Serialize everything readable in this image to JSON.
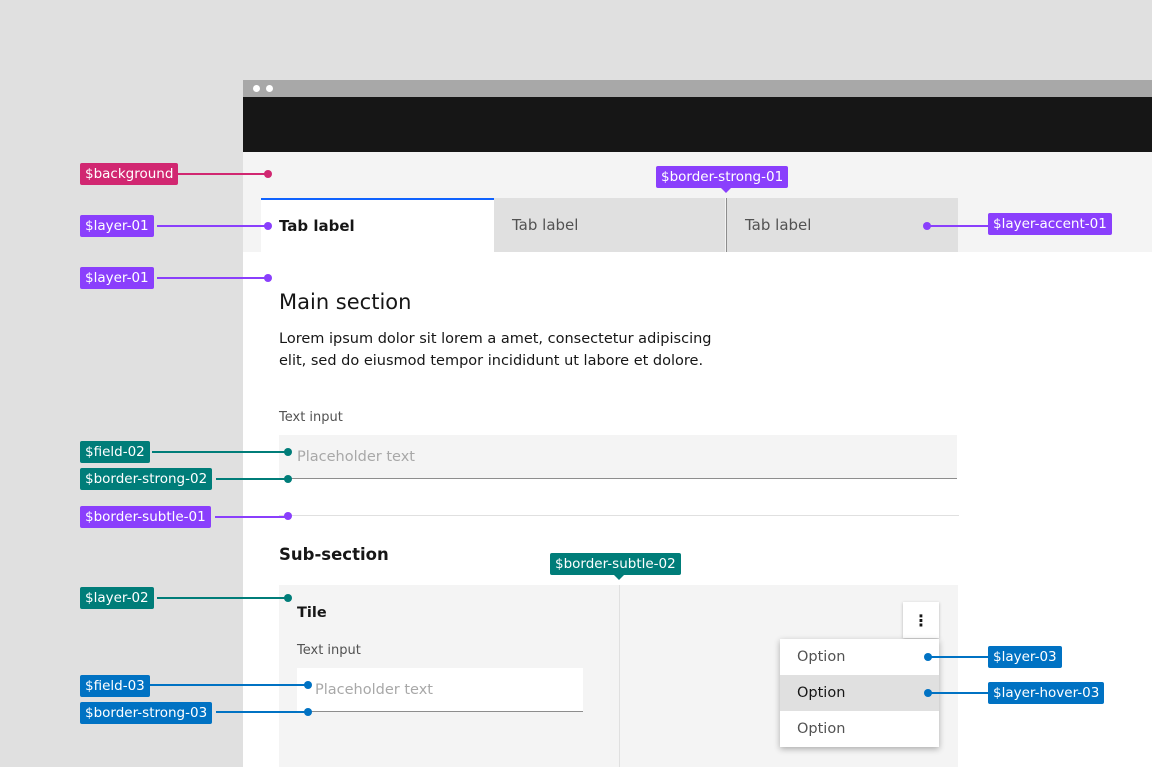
{
  "colors": {
    "magenta": "#d12771",
    "purple": "#8a3ffc",
    "teal": "#007d79",
    "blue": "#0072c3",
    "interactive": "#0f62fe",
    "background": "#f4f4f4",
    "layer_01": "#ffffff",
    "layer_accent_01": "#e0e0e0",
    "header": "#161616"
  },
  "tabs": [
    {
      "label": "Tab label",
      "selected": true
    },
    {
      "label": "Tab label",
      "selected": false
    },
    {
      "label": "Tab label",
      "selected": false
    }
  ],
  "main": {
    "title": "Main section",
    "body": "Lorem ipsum dolor sit lorem a amet, consectetur adipiscing elit, sed do eiusmod tempor incididunt ut labore et dolore.",
    "field_label": "Text input",
    "field_placeholder": "Placeholder text"
  },
  "subsection": {
    "title": "Sub-section",
    "tile": {
      "title": "Tile",
      "field_label": "Text input",
      "field_placeholder": "Placeholder text"
    },
    "overflow_icon": "⋮",
    "menu_options": [
      "Option",
      "Option",
      "Option"
    ]
  },
  "annotations": {
    "background": "$background",
    "layer_01_tab": "$layer-01",
    "layer_01_main": "$layer-01",
    "border_strong_01": "$border-strong-01",
    "layer_accent_01": "$layer-accent-01",
    "field_02": "$field-02",
    "border_strong_02": "$border-strong-02",
    "border_subtle_01": "$border-subtle-01",
    "layer_02": "$layer-02",
    "border_subtle_02": "$border-subtle-02",
    "field_03": "$field-03",
    "border_strong_03": "$border-strong-03",
    "layer_03": "$layer-03",
    "layer_hover_03": "$layer-hover-03"
  }
}
